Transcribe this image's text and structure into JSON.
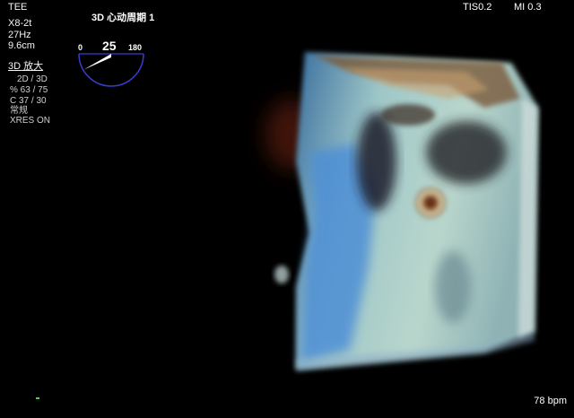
{
  "header": {
    "probe_mode": "TEE",
    "title": "3D 心动周期 1",
    "tis": "TIS0.2",
    "mi": "MI 0.3"
  },
  "left_panel": {
    "probe": "X8-2t",
    "frame_rate": "27Hz",
    "depth": "9.6cm",
    "mode": "3D 放大",
    "view": "2D / 3D",
    "percent": "% 63 / 75",
    "compress": "C 37 / 30",
    "preset": "常规",
    "xres": "XRES ON"
  },
  "rotation_gauge": {
    "min_label": "0",
    "max_label": "180",
    "value_label": "25",
    "value": 25,
    "max": 180
  },
  "footer": {
    "heart_rate": "78 bpm"
  },
  "colors": {
    "background": "#000000",
    "text": "#f2f2f2",
    "gauge": "#3a3ccf",
    "marker": "#4ecf4e"
  }
}
